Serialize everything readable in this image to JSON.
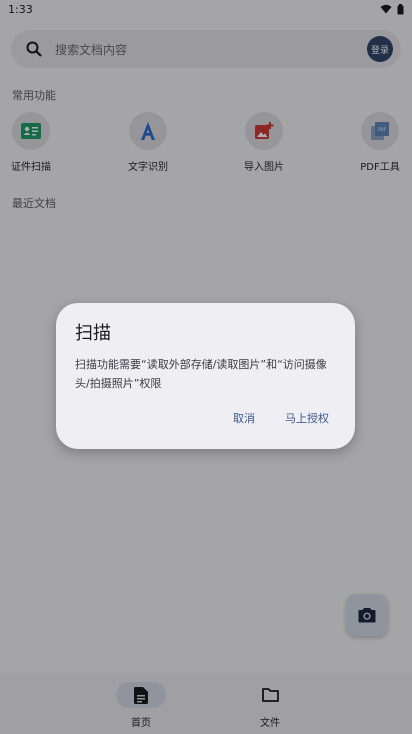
{
  "statusbar": {
    "time": "1:33"
  },
  "search": {
    "placeholder": "搜索文档内容",
    "login_label": "登录"
  },
  "sections": {
    "common": "常用功能",
    "recent": "最近文档"
  },
  "features": [
    {
      "label": "证件扫描",
      "icon": "id-card-icon"
    },
    {
      "label": "文字识别",
      "icon": "text-a-icon"
    },
    {
      "label": "导入图片",
      "icon": "add-image-icon"
    },
    {
      "label": "PDF工具",
      "icon": "pdf-icon"
    }
  ],
  "nav": [
    {
      "label": "首页",
      "icon": "document-icon",
      "active": true
    },
    {
      "label": "文件",
      "icon": "folder-icon",
      "active": false
    }
  ],
  "dialog": {
    "title": "扫描",
    "body": "扫描功能需要“读取外部存储/读取图片”和“访问摄像头/拍摄照片”权限",
    "cancel": "取消",
    "confirm": "马上授权"
  },
  "colors": {
    "accent": "#32466b",
    "dialog_button": "#3a5a8c",
    "feature_green": "#1e9e6a",
    "feature_blue": "#2f6fd0",
    "feature_red": "#d43a3a"
  }
}
